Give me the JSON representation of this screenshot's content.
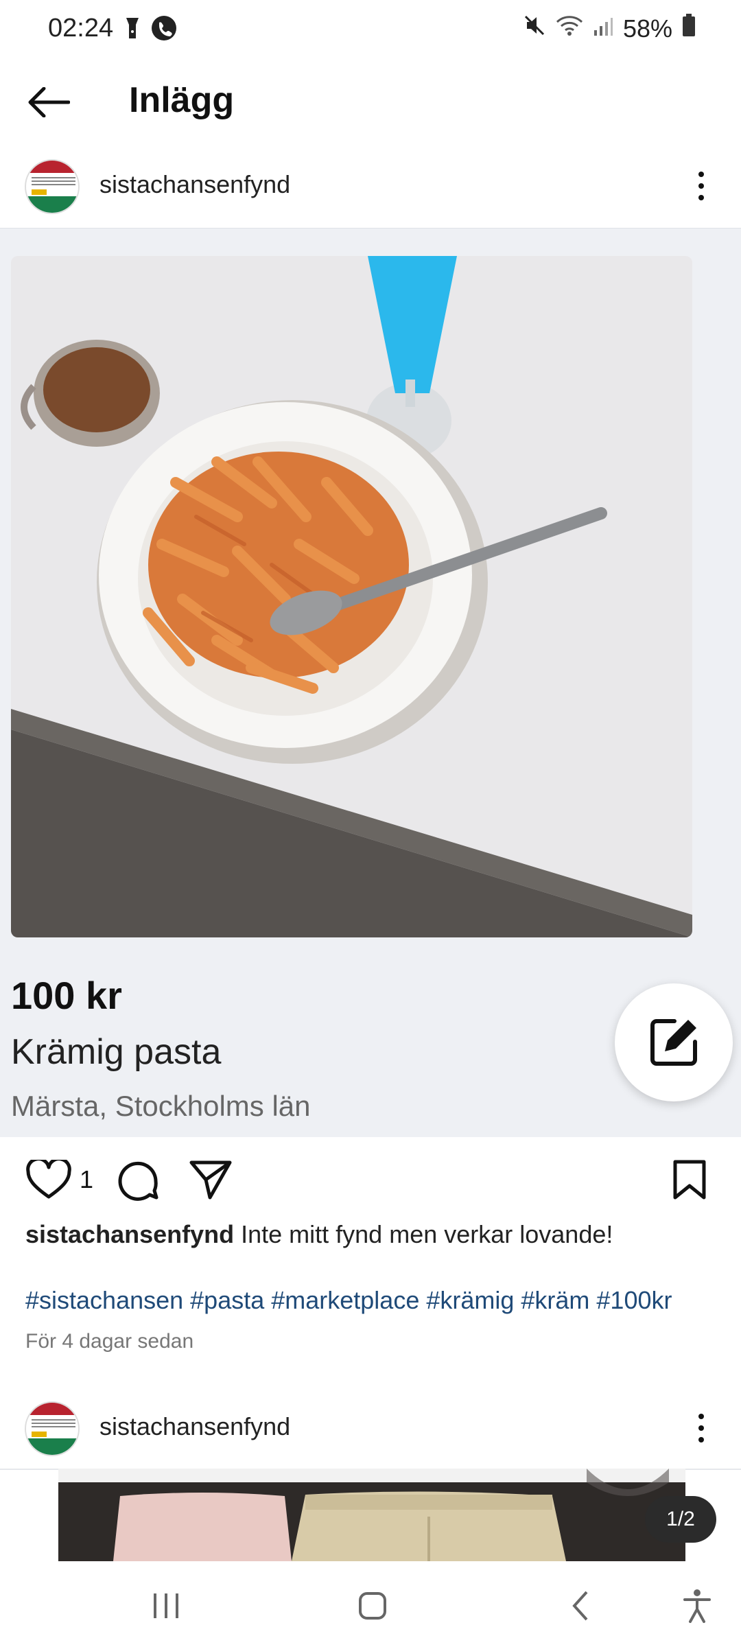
{
  "status_bar": {
    "time": "02:24",
    "battery": "58%"
  },
  "header": {
    "title": "Inlägg"
  },
  "post": {
    "username": "sistachansenfynd",
    "listing": {
      "price": "100 kr",
      "title": "Krämig pasta",
      "location": "Märsta, Stockholms län"
    },
    "like_count": "1",
    "caption_user": "sistachansenfynd",
    "caption_text": " Inte mitt fynd men verkar lovande!",
    "hashtags": "#sistachansen #pasta #marketplace #krämig #kräm #100kr",
    "time_ago": "För 4 dagar sedan"
  },
  "post2": {
    "username": "sistachansenfynd",
    "page_counter": "1/2"
  },
  "colors": {
    "hashtag": "#1f4a78",
    "listing_bg": "#eef0f4"
  }
}
